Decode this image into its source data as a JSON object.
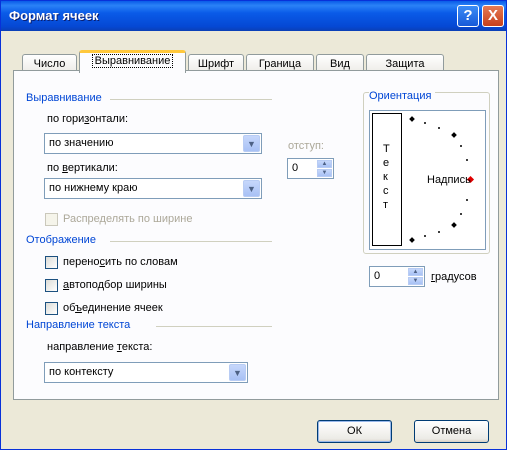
{
  "window": {
    "title": "Формат ячеек",
    "help_glyph": "?",
    "close_glyph": "X"
  },
  "tabs": [
    {
      "label": "Число"
    },
    {
      "label": "Выравнивание"
    },
    {
      "label": "Шрифт"
    },
    {
      "label": "Граница"
    },
    {
      "label": "Вид"
    },
    {
      "label": "Защита"
    }
  ],
  "alignment": {
    "section_label": "Выравнивание",
    "horizontal_label_pre": "по гори",
    "horizontal_label_u": "з",
    "horizontal_label_post": "онтали:",
    "horizontal_value": "по значению",
    "vertical_label_pre": "по ",
    "vertical_label_u": "в",
    "vertical_label_post": "ертикали:",
    "vertical_value": "по нижнему краю",
    "indent_label": "отступ:",
    "indent_value": "0",
    "distribute_label": "Распределять по ширине"
  },
  "display": {
    "section_label": "Отображение",
    "wrap_pre": "перено",
    "wrap_u": "с",
    "wrap_post": "ить по словам",
    "autofit_u": "а",
    "autofit_post": "втоподбор ширины",
    "merge_pre": "об",
    "merge_u": "ъ",
    "merge_post": "единение ячеек"
  },
  "text_direction": {
    "section_label": "Направление текста",
    "label_pre": "направление ",
    "label_u": "т",
    "label_post": "екста:",
    "value": "по контексту"
  },
  "orientation": {
    "section_label": "Ориентация",
    "vertical_letters": [
      "Т",
      "е",
      "к",
      "с",
      "т"
    ],
    "needle_label": "Надпись",
    "degrees_value": "0",
    "degrees_label_u": "г",
    "degrees_label_post": "радусов",
    "marker_color": "#E00000"
  },
  "buttons": {
    "ok": "ОК",
    "cancel": "Отмена"
  }
}
